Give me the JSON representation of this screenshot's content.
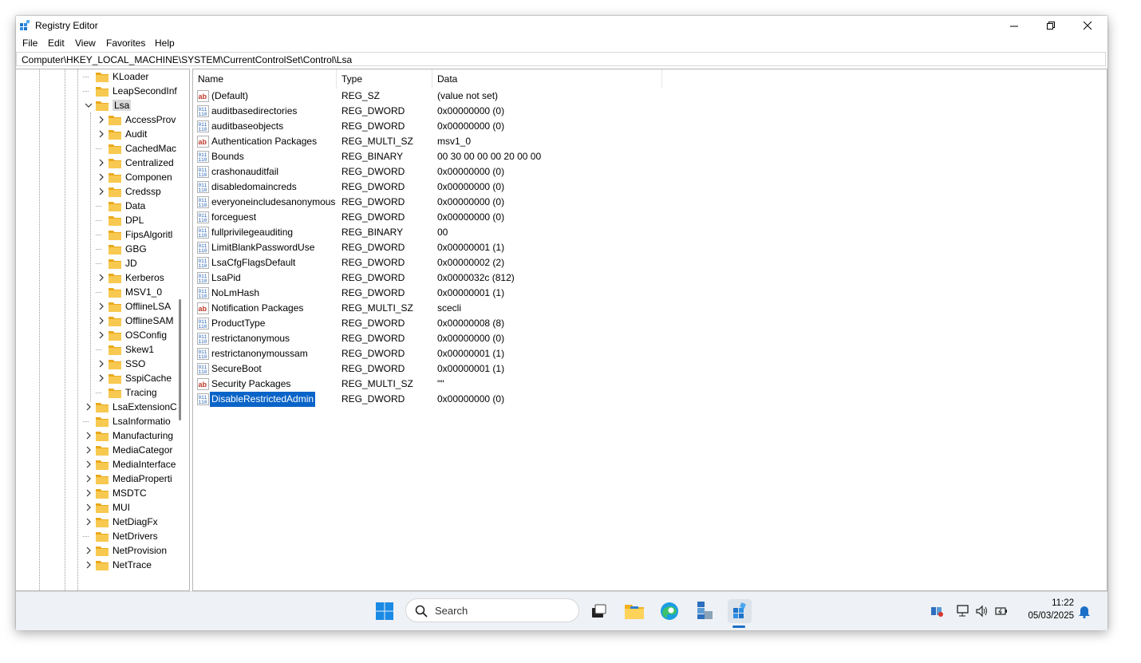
{
  "window": {
    "title": "Registry Editor"
  },
  "menu": [
    "File",
    "Edit",
    "View",
    "Favorites",
    "Help"
  ],
  "address": "Computer\\HKEY_LOCAL_MACHINE\\SYSTEM\\CurrentControlSet\\Control\\Lsa",
  "tree": {
    "items": [
      {
        "label": "KLoader",
        "level": 0,
        "expander": "none"
      },
      {
        "label": "LeapSecondInf",
        "level": 0,
        "expander": "none"
      },
      {
        "label": "Lsa",
        "level": 0,
        "expander": "expanded",
        "selected": true
      },
      {
        "label": "AccessProv",
        "level": 1,
        "expander": "collapsed"
      },
      {
        "label": "Audit",
        "level": 1,
        "expander": "collapsed"
      },
      {
        "label": "CachedMac",
        "level": 1,
        "expander": "none"
      },
      {
        "label": "Centralized",
        "level": 1,
        "expander": "collapsed"
      },
      {
        "label": "Componen",
        "level": 1,
        "expander": "collapsed"
      },
      {
        "label": "Credssp",
        "level": 1,
        "expander": "collapsed"
      },
      {
        "label": "Data",
        "level": 1,
        "expander": "none"
      },
      {
        "label": "DPL",
        "level": 1,
        "expander": "none"
      },
      {
        "label": "FipsAlgoritl",
        "level": 1,
        "expander": "none"
      },
      {
        "label": "GBG",
        "level": 1,
        "expander": "none"
      },
      {
        "label": "JD",
        "level": 1,
        "expander": "none"
      },
      {
        "label": "Kerberos",
        "level": 1,
        "expander": "collapsed"
      },
      {
        "label": "MSV1_0",
        "level": 1,
        "expander": "none"
      },
      {
        "label": "OfflineLSA",
        "level": 1,
        "expander": "collapsed"
      },
      {
        "label": "OfflineSAM",
        "level": 1,
        "expander": "collapsed"
      },
      {
        "label": "OSConfig",
        "level": 1,
        "expander": "collapsed"
      },
      {
        "label": "Skew1",
        "level": 1,
        "expander": "none"
      },
      {
        "label": "SSO",
        "level": 1,
        "expander": "collapsed"
      },
      {
        "label": "SspiCache",
        "level": 1,
        "expander": "collapsed"
      },
      {
        "label": "Tracing",
        "level": 1,
        "expander": "none"
      },
      {
        "label": "LsaExtensionC",
        "level": 0,
        "expander": "collapsed"
      },
      {
        "label": "LsaInformatio",
        "level": 0,
        "expander": "none"
      },
      {
        "label": "Manufacturing",
        "level": 0,
        "expander": "collapsed"
      },
      {
        "label": "MediaCategor",
        "level": 0,
        "expander": "collapsed"
      },
      {
        "label": "MediaInterface",
        "level": 0,
        "expander": "collapsed"
      },
      {
        "label": "MediaProperti",
        "level": 0,
        "expander": "collapsed"
      },
      {
        "label": "MSDTC",
        "level": 0,
        "expander": "collapsed"
      },
      {
        "label": "MUI",
        "level": 0,
        "expander": "collapsed"
      },
      {
        "label": "NetDiagFx",
        "level": 0,
        "expander": "collapsed"
      },
      {
        "label": "NetDrivers",
        "level": 0,
        "expander": "none"
      },
      {
        "label": "NetProvision",
        "level": 0,
        "expander": "collapsed"
      },
      {
        "label": "NetTrace",
        "level": 0,
        "expander": "collapsed"
      }
    ]
  },
  "list": {
    "columns": [
      "Name",
      "Type",
      "Data"
    ],
    "rows": [
      {
        "icon": "string-value-icon",
        "name": "(Default)",
        "type": "REG_SZ",
        "data": "(value not set)"
      },
      {
        "icon": "binary-value-icon",
        "name": "auditbasedirectories",
        "type": "REG_DWORD",
        "data": "0x00000000 (0)"
      },
      {
        "icon": "binary-value-icon",
        "name": "auditbaseobjects",
        "type": "REG_DWORD",
        "data": "0x00000000 (0)"
      },
      {
        "icon": "string-value-icon",
        "name": "Authentication Packages",
        "type": "REG_MULTI_SZ",
        "data": "msv1_0"
      },
      {
        "icon": "binary-value-icon",
        "name": "Bounds",
        "type": "REG_BINARY",
        "data": "00 30 00 00 00 20 00 00"
      },
      {
        "icon": "binary-value-icon",
        "name": "crashonauditfail",
        "type": "REG_DWORD",
        "data": "0x00000000 (0)"
      },
      {
        "icon": "binary-value-icon",
        "name": "disabledomaincreds",
        "type": "REG_DWORD",
        "data": "0x00000000 (0)"
      },
      {
        "icon": "binary-value-icon",
        "name": "everyoneincludesanonymous",
        "type": "REG_DWORD",
        "data": "0x00000000 (0)"
      },
      {
        "icon": "binary-value-icon",
        "name": "forceguest",
        "type": "REG_DWORD",
        "data": "0x00000000 (0)"
      },
      {
        "icon": "binary-value-icon",
        "name": "fullprivilegeauditing",
        "type": "REG_BINARY",
        "data": "00"
      },
      {
        "icon": "binary-value-icon",
        "name": "LimitBlankPasswordUse",
        "type": "REG_DWORD",
        "data": "0x00000001 (1)"
      },
      {
        "icon": "binary-value-icon",
        "name": "LsaCfgFlagsDefault",
        "type": "REG_DWORD",
        "data": "0x00000002 (2)"
      },
      {
        "icon": "binary-value-icon",
        "name": "LsaPid",
        "type": "REG_DWORD",
        "data": "0x0000032c (812)"
      },
      {
        "icon": "binary-value-icon",
        "name": "NoLmHash",
        "type": "REG_DWORD",
        "data": "0x00000001 (1)"
      },
      {
        "icon": "string-value-icon",
        "name": "Notification Packages",
        "type": "REG_MULTI_SZ",
        "data": "scecli"
      },
      {
        "icon": "binary-value-icon",
        "name": "ProductType",
        "type": "REG_DWORD",
        "data": "0x00000008 (8)"
      },
      {
        "icon": "binary-value-icon",
        "name": "restrictanonymous",
        "type": "REG_DWORD",
        "data": "0x00000000 (0)"
      },
      {
        "icon": "binary-value-icon",
        "name": "restrictanonymoussam",
        "type": "REG_DWORD",
        "data": "0x00000001 (1)"
      },
      {
        "icon": "binary-value-icon",
        "name": "SecureBoot",
        "type": "REG_DWORD",
        "data": "0x00000001 (1)"
      },
      {
        "icon": "string-value-icon",
        "name": "Security Packages",
        "type": "REG_MULTI_SZ",
        "data": "\"\""
      },
      {
        "icon": "binary-value-icon",
        "name": "DisableRestrictedAdmin",
        "type": "REG_DWORD",
        "data": "0x00000000 (0)",
        "selected": true
      }
    ]
  },
  "taskbar": {
    "search_placeholder": "Search",
    "time": "11:22",
    "date": "05/03/2025",
    "icons": [
      "windows-start-icon",
      "search-icon",
      "task-view-icon",
      "file-explorer-icon",
      "edge-icon",
      "network-tool-icon",
      "registry-editor-icon"
    ],
    "tray_icons": [
      "tray-app-icon",
      "network-icon",
      "volume-icon",
      "battery-icon",
      "notification-bell-icon"
    ]
  },
  "colors": {
    "selection": "#0a64c8",
    "folder": "#f5c242",
    "taskbar_bg": "#eef1f5"
  }
}
